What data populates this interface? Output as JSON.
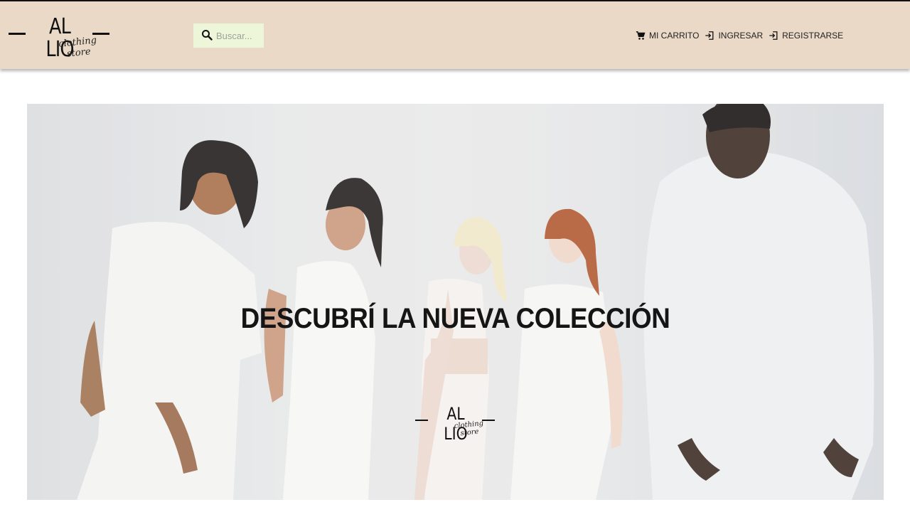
{
  "header": {
    "logo": {
      "word": "AL LIO",
      "tagline": "clothing store"
    },
    "search": {
      "placeholder": "Buscar..."
    },
    "nav": [
      {
        "label": "MI CARRITO",
        "icon": "cart-icon"
      },
      {
        "label": "INGRESAR",
        "icon": "login-icon"
      },
      {
        "label": "REGISTRARSE",
        "icon": "login-icon"
      }
    ]
  },
  "hero": {
    "headline": "DESCUBRÍ LA NUEVA COLECCIÓN",
    "logo": {
      "word": "AL LIO",
      "tagline": "clothing store"
    }
  },
  "colors": {
    "header_bg": "#ead9c7",
    "search_bg": "#eef6da",
    "text": "#111111"
  }
}
